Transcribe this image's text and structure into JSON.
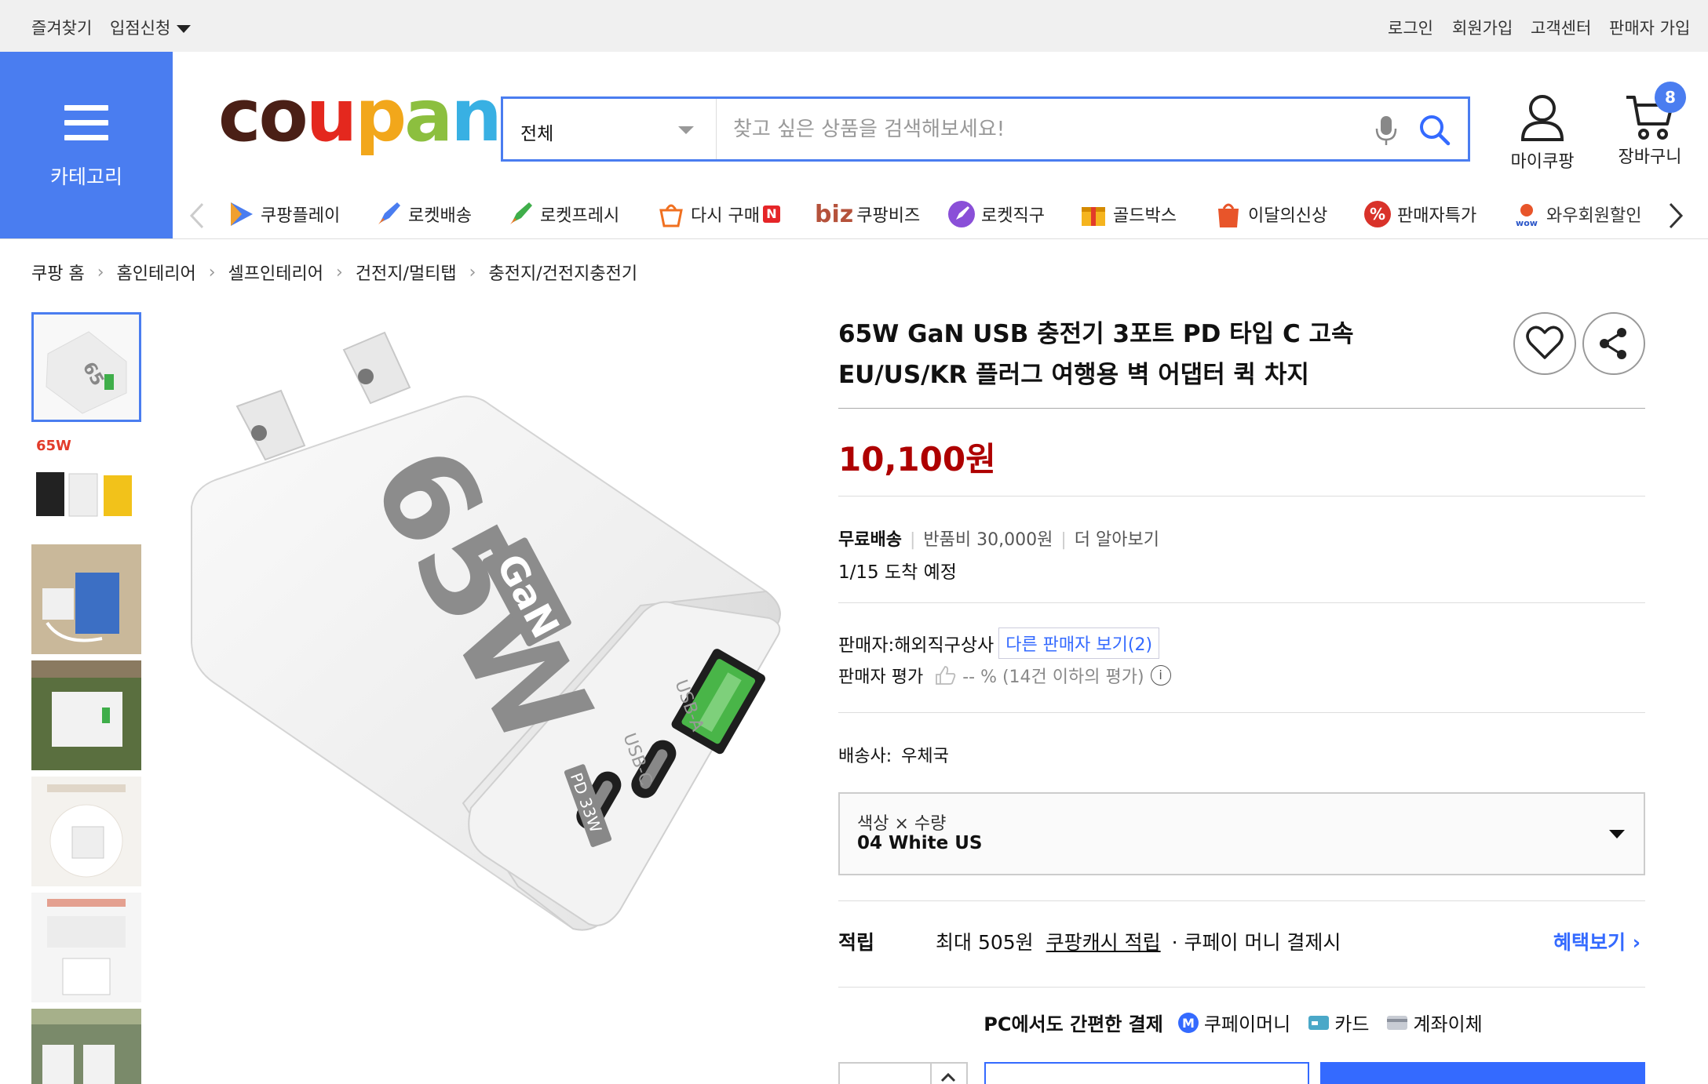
{
  "topbar": {
    "left": [
      "즐겨찾기",
      "입점신청"
    ],
    "right": [
      "로그인",
      "회원가입",
      "고객센터",
      "판매자 가입"
    ]
  },
  "header": {
    "category_label": "카테고리",
    "logo_text": "coupang",
    "search_category": "전체",
    "search_placeholder": "찾고 싶은 상품을 검색해보세요!",
    "mycoupang_label": "마이쿠팡",
    "cart_label": "장바구니",
    "cart_count": "8"
  },
  "nav": {
    "items": [
      {
        "label": "쿠팡플레이",
        "icon": "play-icon"
      },
      {
        "label": "로켓배송",
        "icon": "rocket-icon"
      },
      {
        "label": "로켓프레시",
        "icon": "rocket-fresh-icon"
      },
      {
        "label": "다시 구매",
        "icon": "rebuy-icon",
        "badge": "N"
      },
      {
        "label": "쿠팡비즈",
        "icon": "biz-icon",
        "prefix": "biz"
      },
      {
        "label": "로켓직구",
        "icon": "rocket-global-icon"
      },
      {
        "label": "골드박스",
        "icon": "goldbox-icon"
      },
      {
        "label": "이달의신상",
        "icon": "new-icon"
      },
      {
        "label": "판매자특가",
        "icon": "seller-deal-icon"
      },
      {
        "label": "와우회원할인",
        "icon": "wow-icon"
      }
    ]
  },
  "breadcrumb": [
    "쿠팡 홈",
    "홈인테리어",
    "셀프인테리어",
    "건전지/멀티탭",
    "충전지/건전지충전기"
  ],
  "product": {
    "title": "65W GaN USB 충전기 3포트 PD 타입 C 고속 EU/US/KR 플러그 여행용 벽 어댑터 퀵 차지",
    "price": "10,100원",
    "shipping": {
      "free": "무료배송",
      "return_fee": "반품비 30,000원",
      "more": "더 알아보기",
      "arrival": "1/15 도착 예정"
    },
    "seller": {
      "label": "판매자:",
      "name": "해외직구상사",
      "other_sellers": "다른 판매자 보기(2)",
      "rating_label": "판매자 평가",
      "rating_value": "-- % (14건 이하의 평가)"
    },
    "carrier": {
      "label": "배송사:",
      "name": "우체국"
    },
    "option": {
      "label": "색상 × 수량",
      "value": "04 White US"
    },
    "reward": {
      "label": "적립",
      "max": "최대 505원",
      "cash": "쿠팡캐시 적립",
      "note": "· 쿠페이 머니 결제시",
      "more": "혜택보기 ›"
    },
    "payment": {
      "title": "PC에서도 간편한 결제",
      "methods": [
        "쿠페이머니",
        "카드",
        "계좌이체"
      ]
    },
    "image_text": {
      "watts": "65W",
      "gan": "GaN",
      "usb_a": "USB-A",
      "usb_c": "USB-C",
      "pd": "PD 33W"
    }
  },
  "colors": {
    "accent": "#4a7df0",
    "link": "#346aff",
    "price": "#ae0000"
  }
}
